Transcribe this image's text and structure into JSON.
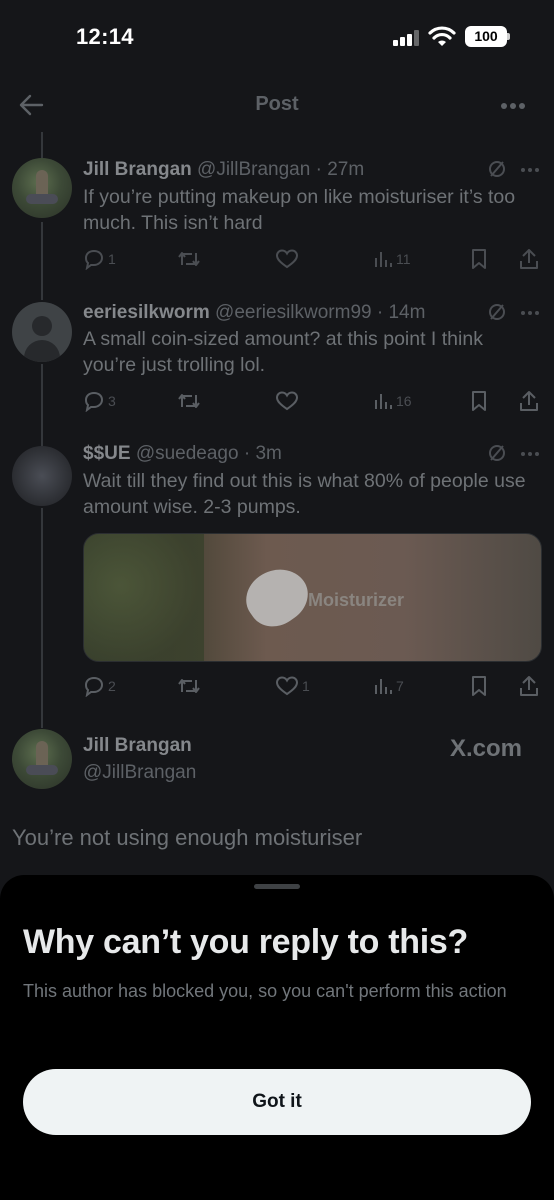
{
  "status_bar": {
    "time": "12:14",
    "battery": "100"
  },
  "header": {
    "title": "Post"
  },
  "tweets": [
    {
      "name": "Jill Brangan",
      "handle": "@JillBrangan",
      "time": "· 27m",
      "text": "If you’re putting makeup on like moisturiser it’s too much. This isn’t hard",
      "replies": "1",
      "retweets": "",
      "likes": "",
      "views": "11"
    },
    {
      "name": "eeriesilkworm",
      "handle": "@eeriesilkworm99",
      "time": "· 14m",
      "text": "A small coin-sized amount? at this point I think you’re just trolling lol.",
      "replies": "3",
      "retweets": "",
      "likes": "",
      "views": "16"
    },
    {
      "name": "$$UE",
      "handle": "@suedeago",
      "time": "· 3m",
      "text": "Wait till they find out this is what 80% of people use amount wise. 2-3 pumps.",
      "media_watermark": "Moisturizer",
      "replies": "2",
      "retweets": "",
      "likes": "1",
      "views": "7"
    }
  ],
  "quoted": {
    "name": "Jill Brangan",
    "handle": "@JillBrangan",
    "site": "X.com",
    "text": "You’re not using enough moisturiser"
  },
  "sheet": {
    "title": "Why can’t you reply to this?",
    "body": "This author has blocked you, so you can't perform this action",
    "button_label": "Got it"
  },
  "colors": {
    "background": "#151619",
    "sheet_background": "#000000",
    "button_background": "#eff3f4",
    "muted_text": "#6e7276"
  }
}
